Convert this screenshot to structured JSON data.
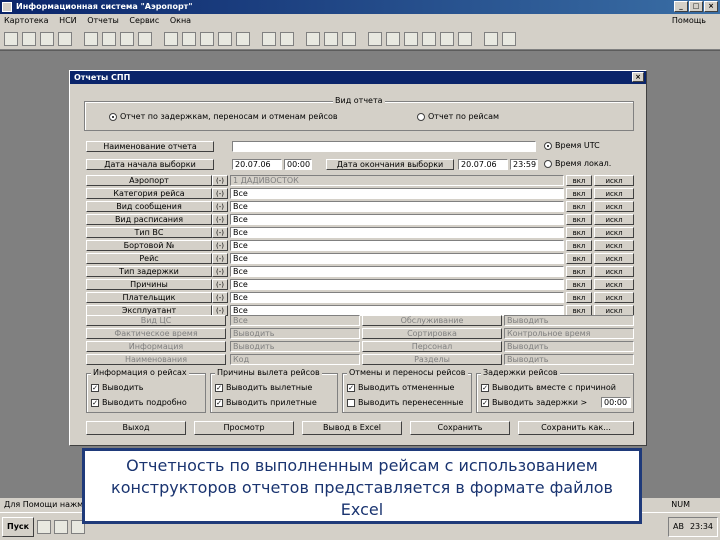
{
  "window": {
    "title": "Информационная система \"Аэропорт\"",
    "min": "_",
    "max": "□",
    "close": "×"
  },
  "menu": {
    "items": [
      "Картотека",
      "НСИ",
      "Отчеты",
      "Сервис",
      "Окна"
    ],
    "help": "Помощь"
  },
  "dialog": {
    "title": "Отчеты СПП",
    "close": "×",
    "report_type_caption": "Вид отчета",
    "radio_delays": "Отчет по задержкам, переносам и отменам рейсов",
    "radio_flights": "Отчет по рейсам",
    "report_name_label": "Наименование отчета",
    "period_label": "Дата начала выборки",
    "date_from": "20.07.06",
    "time_from": "00:00",
    "period_end_label": "Дата окончания выборки",
    "date_to": "20.07.06",
    "time_to": "23:59",
    "time_utc": "Время UTC",
    "time_local": "Время локал.",
    "filters": [
      {
        "label": "Аэропорт",
        "value": "1 ДАДИВОСТОК",
        "marker": "(-)",
        "on": "вкл",
        "off": "искл"
      },
      {
        "label": "Категория рейса",
        "value": "Все",
        "marker": "(-)",
        "on": "вкл",
        "off": "искл"
      },
      {
        "label": "Вид сообщения",
        "value": "Все",
        "marker": "(-)",
        "on": "вкл",
        "off": "искл"
      },
      {
        "label": "Вид расписания",
        "value": "Все",
        "marker": "(-)",
        "on": "вкл",
        "off": "искл"
      },
      {
        "label": "Тип ВС",
        "value": "Все",
        "marker": "(-)",
        "on": "вкл",
        "off": "искл"
      },
      {
        "label": "Бортовой №",
        "value": "Все",
        "marker": "(-)",
        "on": "вкл",
        "off": "искл"
      },
      {
        "label": "Рейс",
        "value": "Все",
        "marker": "(-)",
        "on": "вкл",
        "off": "искл"
      },
      {
        "label": "Тип задержки",
        "value": "Все",
        "marker": "(-)",
        "on": "вкл",
        "off": "искл"
      },
      {
        "label": "Причины",
        "value": "Все",
        "marker": "(-)",
        "on": "вкл",
        "off": "искл"
      },
      {
        "label": "Плательщик",
        "value": "Все",
        "marker": "(-)",
        "on": "вкл",
        "off": "искл"
      },
      {
        "label": "Эксплуатант",
        "value": "Все",
        "marker": "(-)",
        "on": "вкл",
        "off": "искл"
      }
    ],
    "extra_left": [
      {
        "label": "Вид ЦС",
        "value": "Все"
      },
      {
        "label": "Фактическое время",
        "value": "Выводить"
      },
      {
        "label": "Информация",
        "value": "Выводить"
      },
      {
        "label": "Наименования",
        "value": "Код"
      }
    ],
    "extra_right": [
      {
        "label": "Обслуживание",
        "value": "Выводить"
      },
      {
        "label": "Сортировка",
        "value": "Контрольное время"
      },
      {
        "label": "Персонал",
        "value": "Выводить"
      },
      {
        "label": "Разделы",
        "value": "Выводить"
      }
    ],
    "groups": [
      {
        "caption": "Информация о рейсах",
        "c1": "Выводить",
        "c2": "Выводить подробно"
      },
      {
        "caption": "Причины вылета рейсов",
        "c1": "Выводить вылетные",
        "c2": "Выводить прилетные"
      },
      {
        "caption": "Отмены и переносы рейсов",
        "c1": "Выводить отмененные",
        "c2": "Выводить перенесенные"
      },
      {
        "caption": "Задержки рейсов",
        "c1": "Выводить вместе с причиной",
        "c2": "Выводить задержки >",
        "value": "00:00"
      }
    ],
    "buttons": {
      "exit": "Выход",
      "preview": "Просмотр",
      "excel": "Вывод в Excel",
      "save": "Сохранить",
      "save_as": "Сохранить как..."
    }
  },
  "caption": "Отчетность по выполненным рейсам с использованием конструкторов отчетов представляется в формате файлов Excel",
  "statusbar": {
    "hint": "Для Помощи нажмите",
    "num": "NUM"
  },
  "taskbar": {
    "start": "Пуск",
    "lang": "AB",
    "time": "23:34"
  }
}
